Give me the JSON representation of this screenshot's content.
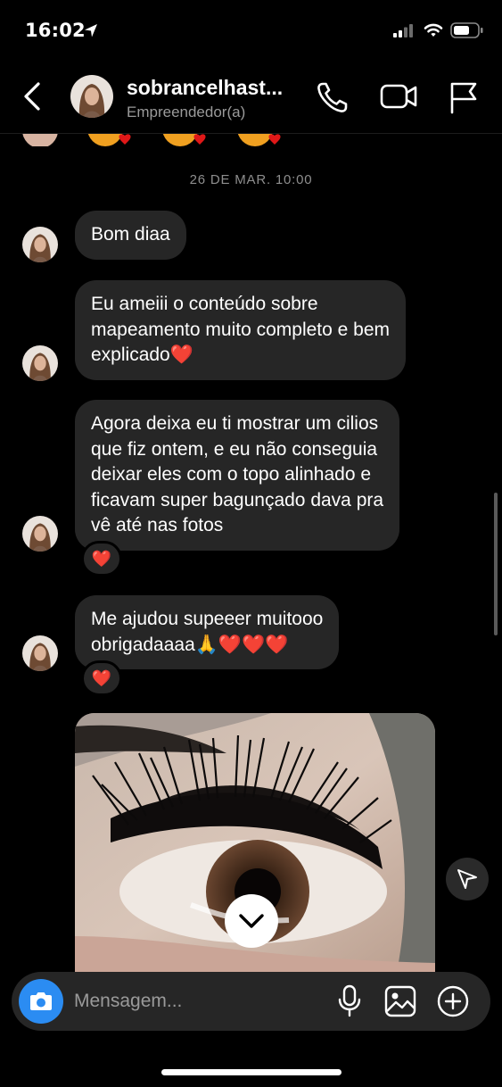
{
  "status_bar": {
    "time": "16:02"
  },
  "header": {
    "name": "sobrancelhast...",
    "subtitle": "Empreendedor(a)"
  },
  "thread": {
    "date_separator": "26 DE MAR. 10:00",
    "messages": [
      {
        "text": "Bom diaa"
      },
      {
        "lines": [
          "Eu ameiii o conteúdo sobre",
          "mapeamento muito completo e bem",
          "explicado❤️"
        ]
      },
      {
        "lines": [
          "Agora deixa eu ti mostrar um cilios",
          "que fiz ontem, e eu não conseguia",
          "deixar eles com o topo alinhado e",
          "ficavam super bagunçado dava pra",
          "vê até nas fotos"
        ],
        "reaction": "❤️"
      },
      {
        "lines": [
          "Me ajudou supeeer muitooo",
          "obrigadaaaa🙏❤️❤️❤️"
        ],
        "reaction": "❤️"
      }
    ]
  },
  "composer": {
    "placeholder": "Mensagem..."
  },
  "colors": {
    "background": "#000000",
    "bubble": "#262626",
    "camera_button": "#2b8cf2",
    "meta_text": "#8e8e8e"
  }
}
